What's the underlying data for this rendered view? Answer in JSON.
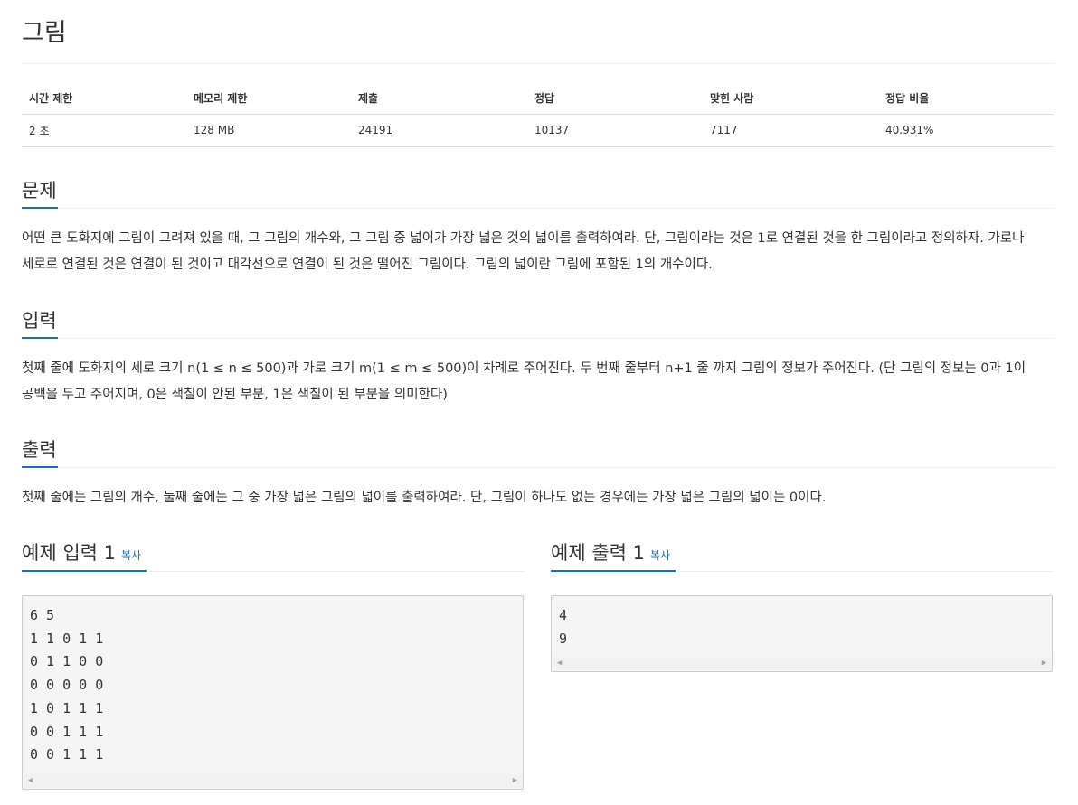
{
  "title": "그림",
  "info_table": {
    "headers": [
      "시간 제한",
      "메모리 제한",
      "제출",
      "정답",
      "맞힌 사람",
      "정답 비율"
    ],
    "values": [
      "2 초",
      "128 MB",
      "24191",
      "10137",
      "7117",
      "40.931%"
    ]
  },
  "problem": {
    "heading": "문제",
    "text": "어떤 큰 도화지에 그림이 그려져 있을 때, 그 그림의 개수와, 그 그림 중 넓이가 가장 넓은 것의 넓이를 출력하여라. 단, 그림이라는 것은 1로 연결된 것을 한 그림이라고 정의하자. 가로나 세로로 연결된 것은 연결이 된 것이고 대각선으로 연결이 된 것은 떨어진 그림이다. 그림의 넓이란 그림에 포함된 1의 개수이다."
  },
  "input": {
    "heading": "입력",
    "text": "첫째 줄에 도화지의 세로 크기 n(1 ≤ n ≤ 500)과 가로 크기 m(1 ≤ m ≤ 500)이 차례로 주어진다. 두 번째 줄부터 n+1 줄 까지 그림의 정보가 주어진다. (단 그림의 정보는 0과 1이 공백을 두고 주어지며, 0은 색칠이 안된 부분, 1은 색칠이 된 부분을 의미한다)"
  },
  "output": {
    "heading": "출력",
    "text": "첫째 줄에는 그림의 개수, 둘째 줄에는 그 중 가장 넓은 그림의 넓이를 출력하여라. 단, 그림이 하나도 없는 경우에는 가장 넓은 그림의 넓이는 0이다."
  },
  "sample_input": {
    "heading": "예제 입력 1",
    "copy_label": "복사",
    "content": "6 5\n1 1 0 1 1\n0 1 1 0 0\n0 0 0 0 0\n1 0 1 1 1\n0 0 1 1 1\n0 0 1 1 1"
  },
  "sample_output": {
    "heading": "예제 출력 1",
    "copy_label": "복사",
    "content": "4\n9"
  },
  "colors": {
    "accent": "#1e6fb8",
    "text": "#333333",
    "pre_background": "#f5f5f5"
  }
}
